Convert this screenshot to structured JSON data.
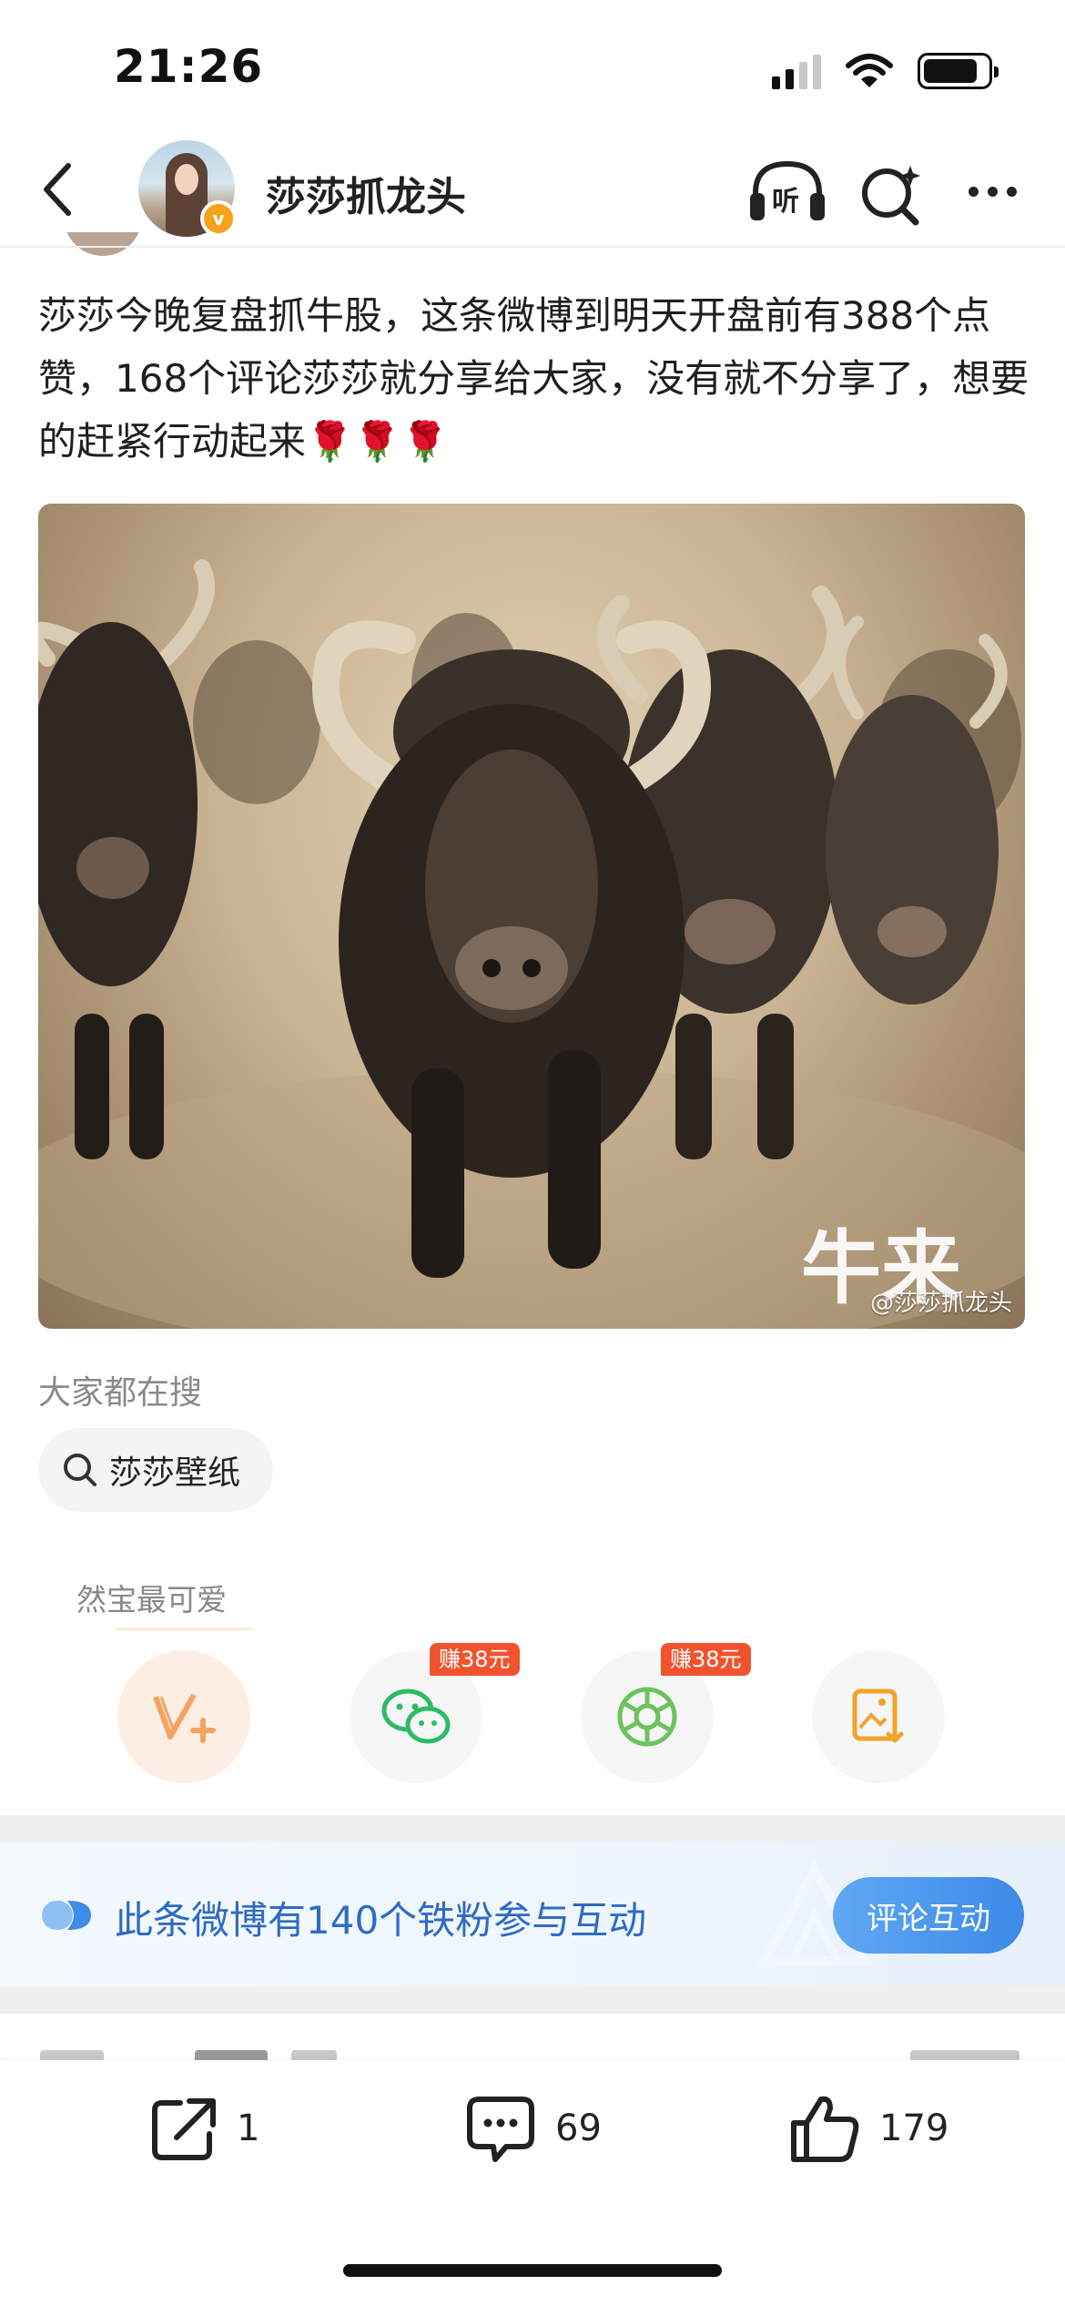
{
  "status_bar": {
    "time": "21:26"
  },
  "header": {
    "user_name": "莎莎抓龙头",
    "listen_label": "听",
    "verified_badge": "v",
    "icons": [
      "chevron-left-icon",
      "headphones-icon",
      "search-sparkle-icon",
      "more-icon"
    ]
  },
  "post": {
    "text": "莎莎今晚复盘抓牛股，这条微博到明天开盘前有388个点赞，168个评论莎莎就分享给大家，没有就不分享了，想要的赶紧行动起来🌹🌹🌹",
    "image": {
      "overlay_text": "牛来",
      "watermark": "@莎莎抓龙头"
    }
  },
  "hot_search": {
    "title": "大家都在搜",
    "chip_label": "莎莎壁纸"
  },
  "promo": {
    "label": "然宝最可爱"
  },
  "share": {
    "items": [
      {
        "name": "vplus-icon",
        "badge": ""
      },
      {
        "name": "wechat-icon",
        "badge": "赚38元"
      },
      {
        "name": "moments-icon",
        "badge": "赚38元"
      },
      {
        "name": "save-image-icon",
        "badge": ""
      }
    ],
    "colors": {
      "vplus": "#f5a35f",
      "wechat": "#2dbb66",
      "moments": "#6cc25d",
      "save": "#f3a22a",
      "badge": "#f2532e"
    }
  },
  "fans_banner": {
    "text": "此条微博有140个铁粉参与互动",
    "button": "评论互动",
    "color": "#2f6bc4"
  },
  "bottom_bar": {
    "repost_count": "1",
    "comment_count": "69",
    "like_count": "179"
  }
}
